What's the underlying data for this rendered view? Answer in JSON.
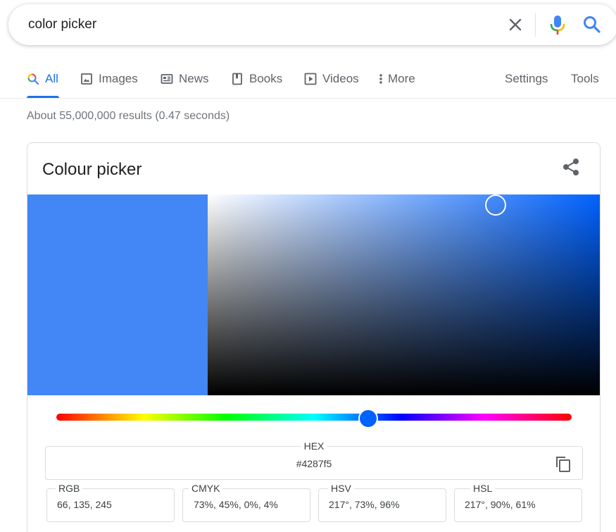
{
  "search": {
    "query": "color picker"
  },
  "tabs": [
    {
      "label": "All",
      "icon": "search-icon"
    },
    {
      "label": "Images",
      "icon": "image-icon"
    },
    {
      "label": "News",
      "icon": "news-icon"
    },
    {
      "label": "Books",
      "icon": "book-icon"
    },
    {
      "label": "Videos",
      "icon": "play-icon"
    },
    {
      "label": "More",
      "icon": "more-vert-icon"
    }
  ],
  "tools": {
    "settings": "Settings",
    "tools": "Tools"
  },
  "stats": "About 55,000,000 results (0.47 seconds)",
  "picker": {
    "title": "Colour picker",
    "selected_color": "#4287f5",
    "hue_color": "#0062ff",
    "hue_position": 0.603,
    "saturation": 0.73,
    "brightness": 0.96,
    "hex": {
      "label": "HEX",
      "value": "#4287f5"
    },
    "rgb": {
      "label": "RGB",
      "value": "66, 135, 245"
    },
    "cmyk": {
      "label": "CMYK",
      "value": "73%, 45%, 0%, 4%"
    },
    "hsv": {
      "label": "HSV",
      "value": "217°, 73%, 96%"
    },
    "hsl": {
      "label": "HSL",
      "value": "217°, 90%, 61%"
    }
  },
  "colors": {
    "accent": "#1a73e8",
    "text_secondary": "#5f6368"
  }
}
